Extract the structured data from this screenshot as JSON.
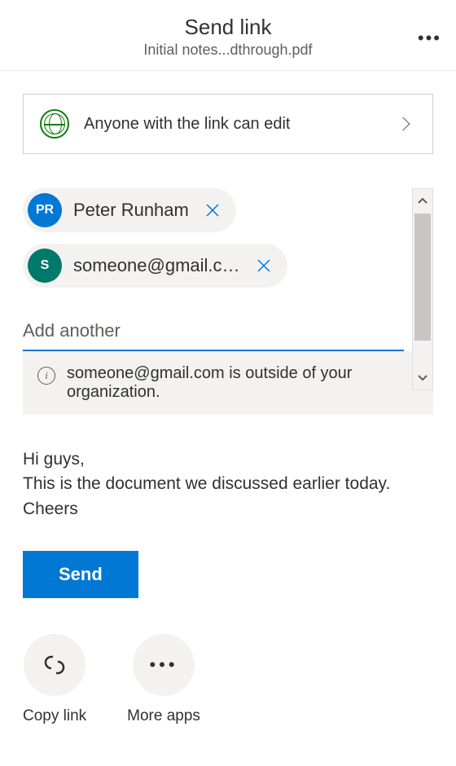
{
  "header": {
    "title": "Send link",
    "subtitle": "Initial notes...dthrough.pdf"
  },
  "permissions": {
    "label": "Anyone with the link can edit"
  },
  "recipients": [
    {
      "initials": "PR",
      "label": "Peter Runham",
      "avatarColor": "blue"
    },
    {
      "initials": "S",
      "label": "someone@gmail.c…",
      "avatarColor": "teal"
    }
  ],
  "addInput": {
    "placeholder": "Add another"
  },
  "warning": {
    "text": "someone@gmail.com is outside of your organization."
  },
  "message": "Hi guys,\nThis is the document we discussed earlier today. Cheers",
  "sendButton": "Send",
  "actions": {
    "copyLink": "Copy link",
    "moreApps": "More apps"
  }
}
